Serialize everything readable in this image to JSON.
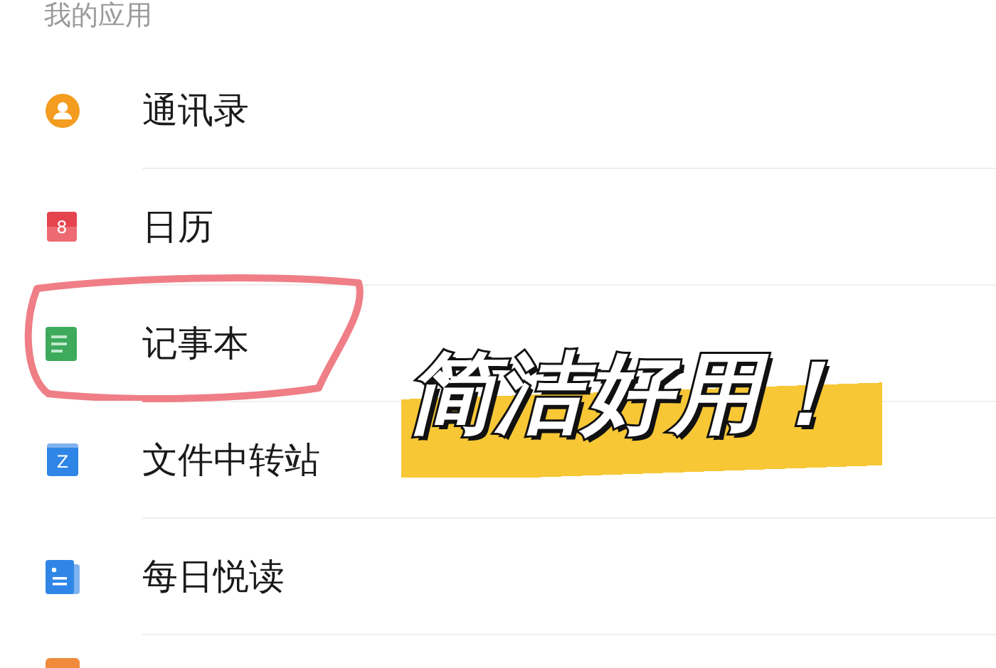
{
  "section_title": "我的应用",
  "apps": [
    {
      "kind": "contact",
      "label": "通讯录",
      "circled": false
    },
    {
      "kind": "calendar",
      "icon_text": "8",
      "label": "日历",
      "circled": false
    },
    {
      "kind": "notes",
      "label": "记事本",
      "circled": true
    },
    {
      "kind": "folder",
      "icon_text": "Z",
      "label": "文件中转站",
      "circled": false
    },
    {
      "kind": "reader",
      "label": "每日悦读",
      "circled": false
    },
    {
      "kind": "orange-doc",
      "circled": false
    }
  ],
  "caption": "简洁好用！"
}
